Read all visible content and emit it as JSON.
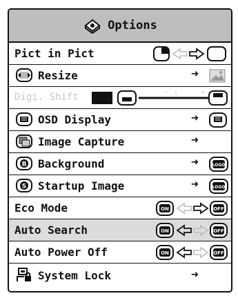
{
  "window": {
    "title": "Options"
  },
  "items": [
    {
      "label": "Pict in Pict"
    },
    {
      "label": "Resize"
    },
    {
      "label": "Digi. Shift"
    },
    {
      "label": "OSD Display"
    },
    {
      "label": "Image Capture"
    },
    {
      "label": "Background"
    },
    {
      "label": "Startup Image"
    },
    {
      "label": "Eco Mode"
    },
    {
      "label": "Auto Search"
    },
    {
      "label": "Auto Power Off"
    },
    {
      "label": "System Lock"
    }
  ],
  "badges": {
    "on": "ON",
    "off": "OFF",
    "logo": "LOGO",
    "b": "B",
    "s": "S"
  },
  "slider": {
    "minus": "−",
    "plus": "+"
  },
  "colors": {
    "header_bg": "#bebebe",
    "highlight_bg": "#dcdcdc",
    "disabled_text": "#c8c8c8",
    "ink": "#111111"
  },
  "icons": {
    "title": "options-icon",
    "resize": "resize-icon",
    "osd": "osd-display-icon",
    "capture": "image-capture-icon",
    "background": "background-icon",
    "startup": "startup-image-icon",
    "lock": "system-lock-icon"
  }
}
